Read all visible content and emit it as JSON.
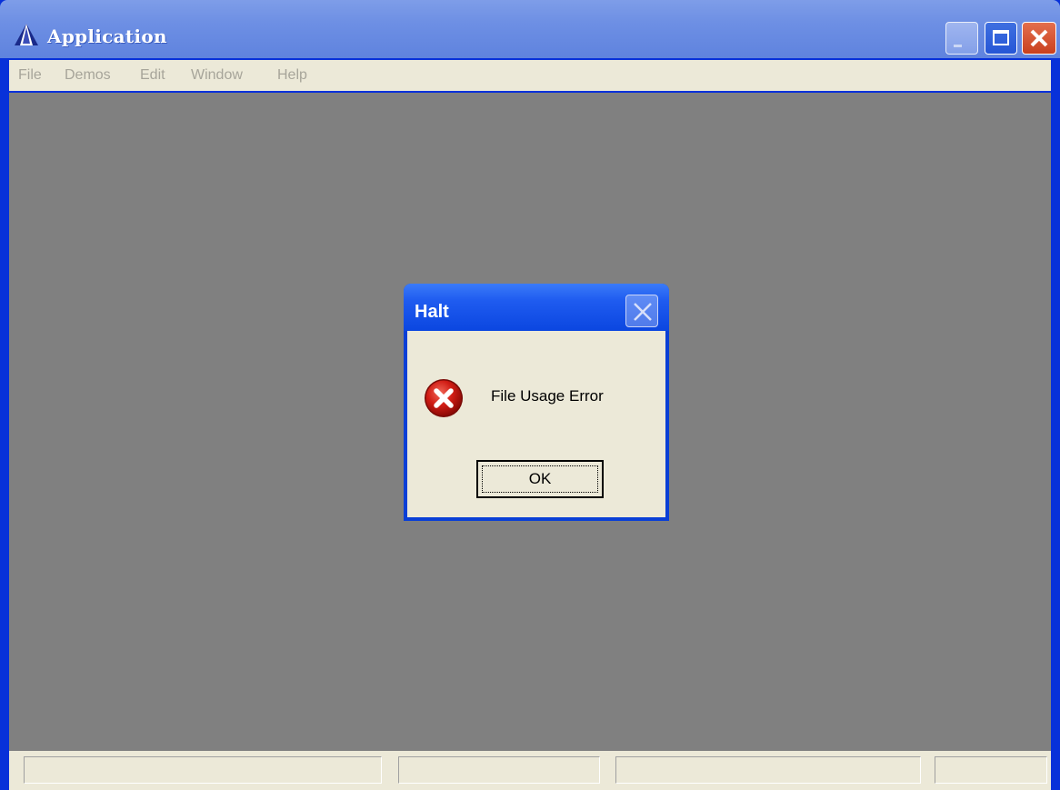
{
  "window": {
    "title": "Application",
    "icon": "app-pyramid-icon",
    "controls": [
      "minimize-icon",
      "maximize-icon",
      "close-icon"
    ]
  },
  "menu": {
    "items": [
      {
        "label": "File"
      },
      {
        "label": "Demos"
      },
      {
        "label": "Edit"
      },
      {
        "label": "Window"
      },
      {
        "label": "Help"
      }
    ]
  },
  "dialog": {
    "title": "Halt",
    "icon": "error-icon",
    "message": "File Usage Error",
    "ok_label": "OK"
  },
  "colors": {
    "title_bar": "#6d8fe4",
    "dialog_title_bar": "#1f5cf0",
    "client_area": "#808080",
    "chrome": "#ece9d8",
    "error_red": "#c81010"
  }
}
